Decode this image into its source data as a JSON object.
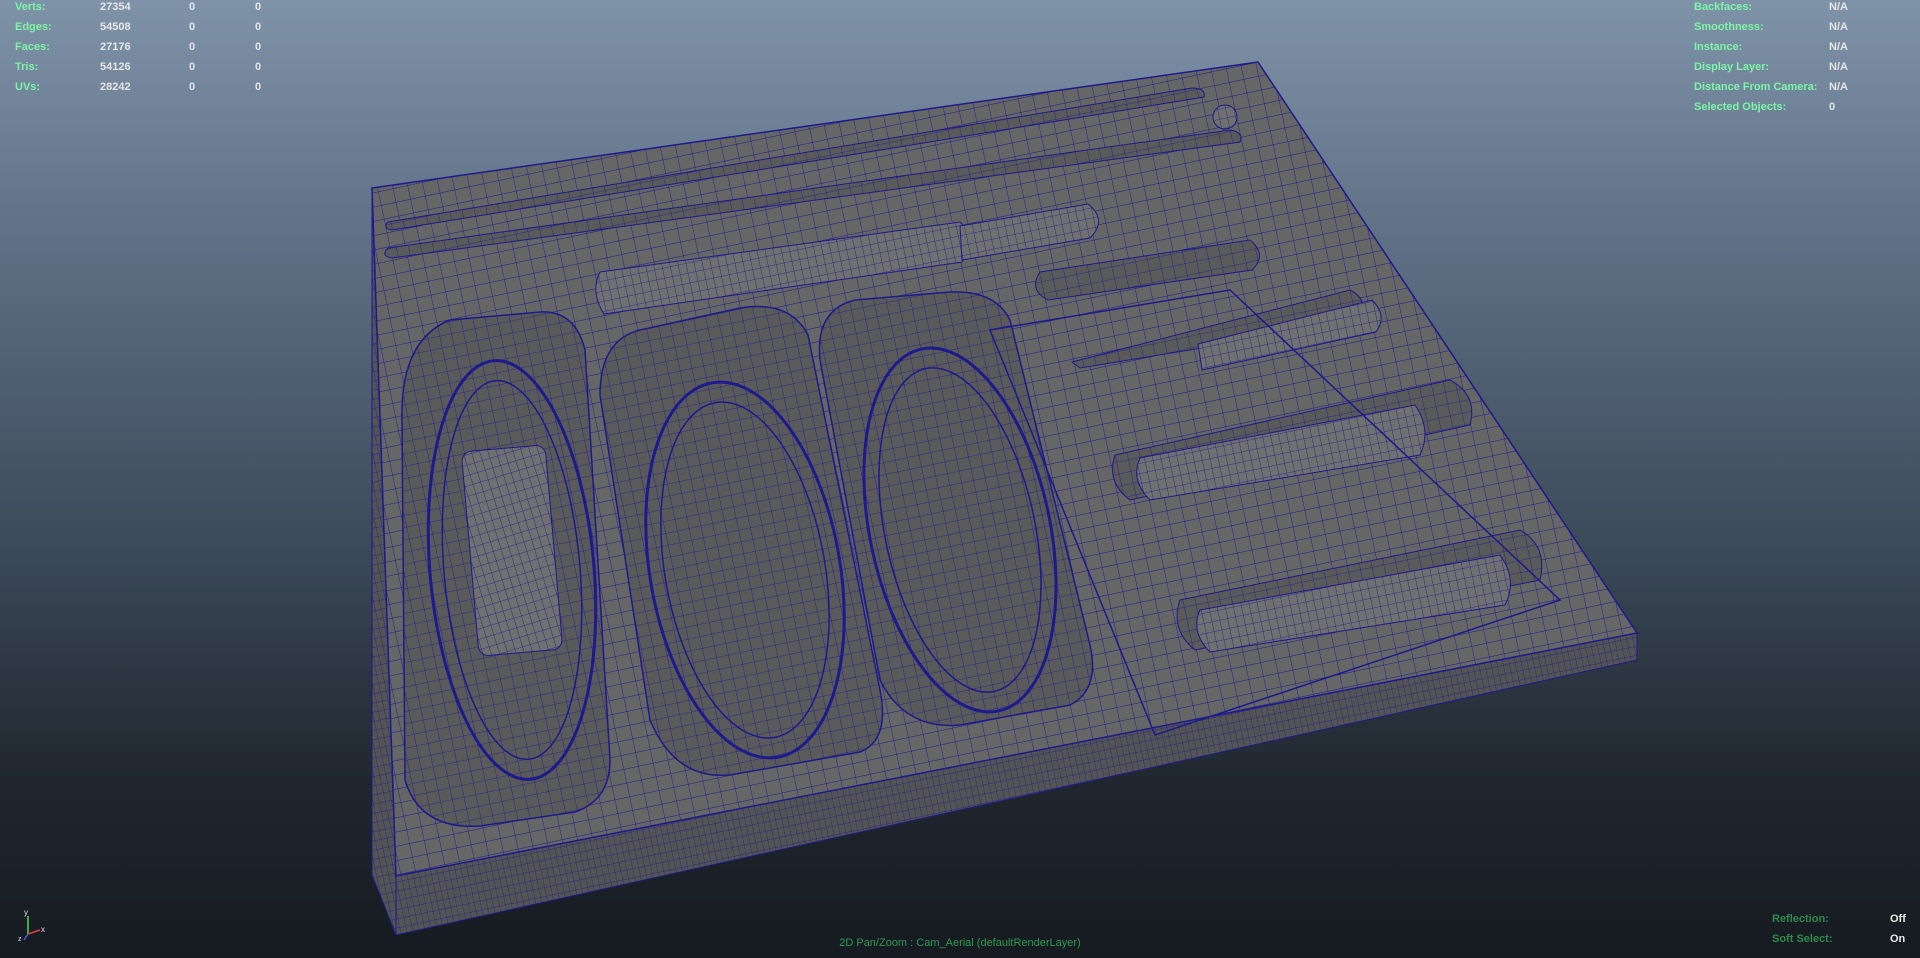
{
  "stats": [
    {
      "label": "Verts:",
      "v1": "27354",
      "v2": "0",
      "v3": "0"
    },
    {
      "label": "Edges:",
      "v1": "54508",
      "v2": "0",
      "v3": "0"
    },
    {
      "label": "Faces:",
      "v1": "27176",
      "v2": "0",
      "v3": "0"
    },
    {
      "label": "Tris:",
      "v1": "54126",
      "v2": "0",
      "v3": "0"
    },
    {
      "label": "UVs:",
      "v1": "28242",
      "v2": "0",
      "v3": "0"
    }
  ],
  "info": [
    {
      "label": "Backfaces:",
      "value": "N/A"
    },
    {
      "label": "Smoothness:",
      "value": "N/A"
    },
    {
      "label": "Instance:",
      "value": "N/A"
    },
    {
      "label": "Display Layer:",
      "value": "N/A"
    },
    {
      "label": "Distance From Camera:",
      "value": "N/A"
    },
    {
      "label": "Selected Objects:",
      "value": "0"
    }
  ],
  "bottom_info": [
    {
      "label": "Reflection:",
      "value": "Off"
    },
    {
      "label": "Soft Select:",
      "value": "On"
    }
  ],
  "camera_label": "2D Pan/Zoom : Cam_Aerial (defaultRenderLayer)",
  "axis": {
    "y": "y",
    "x": "x",
    "z": "z"
  },
  "colors": {
    "wire": "#1c1a8c",
    "surface": "#666666",
    "hud_label": "#7cf5a6"
  }
}
